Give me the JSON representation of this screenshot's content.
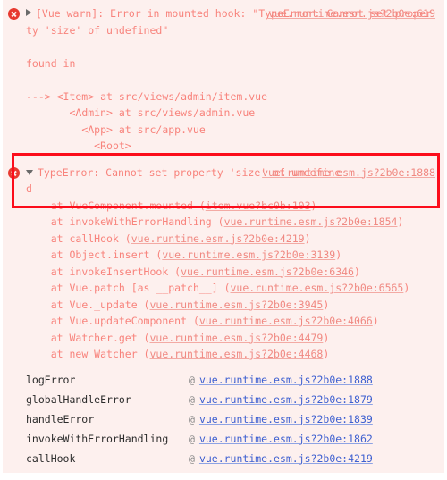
{
  "panel": {
    "name": "browser-devtools-console",
    "background_color": "#fdf0ee",
    "error_text_color": "#f8837c",
    "link_color": "#3d5fd0",
    "highlight_color": "#fc0d1b"
  },
  "entries": [
    {
      "icon": "error-icon",
      "disclosure": "collapsed",
      "message": "[Vue warn]: Error in mounted hook: \"TypeError: Cannot set property 'size' of undefined\"\n\nfound in\n\n---> <Item> at src/views/admin/item.vue\n       <Admin> at src/views/admin.vue\n         <App> at src/app.vue\n           <Root>",
      "source": "vue.runtime.esm.js?2b0e:619"
    },
    {
      "icon": "error-icon",
      "disclosure": "expanded",
      "message_head": "TypeError: Cannot set property 'size' of undefined",
      "source": "vue.runtime.esm.js?2b0e:1888",
      "stack_frames": [
        {
          "fn": "    at VueComponent.mounted (",
          "link": "item.vue?bc0b:103",
          "tail": ")"
        },
        {
          "fn": "    at invokeWithErrorHandling (",
          "link": "vue.runtime.esm.js?2b0e:1854",
          "tail": ")"
        },
        {
          "fn": "    at callHook (",
          "link": "vue.runtime.esm.js?2b0e:4219",
          "tail": ")"
        },
        {
          "fn": "    at Object.insert (",
          "link": "vue.runtime.esm.js?2b0e:3139",
          "tail": ")"
        },
        {
          "fn": "    at invokeInsertHook (",
          "link": "vue.runtime.esm.js?2b0e:6346",
          "tail": ")"
        },
        {
          "fn": "    at Vue.patch [as __patch__] (",
          "link": "vue.runtime.esm.js?2b0e:6565",
          "tail": ")"
        },
        {
          "fn": "    at Vue._update (",
          "link": "vue.runtime.esm.js?2b0e:3945",
          "tail": ")"
        },
        {
          "fn": "    at Vue.updateComponent (",
          "link": "vue.runtime.esm.js?2b0e:4066",
          "tail": ")"
        },
        {
          "fn": "    at Watcher.get (",
          "link": "vue.runtime.esm.js?2b0e:4479",
          "tail": ")"
        },
        {
          "fn": "    at new Watcher (",
          "link": "vue.runtime.esm.js?2b0e:4468",
          "tail": ")"
        }
      ]
    }
  ],
  "call_stack": {
    "at_symbol": "@",
    "rows": [
      {
        "fn": "logError",
        "src": "vue.runtime.esm.js?2b0e:1888"
      },
      {
        "fn": "globalHandleError",
        "src": "vue.runtime.esm.js?2b0e:1879"
      },
      {
        "fn": "handleError",
        "src": "vue.runtime.esm.js?2b0e:1839"
      },
      {
        "fn": "invokeWithErrorHandling",
        "src": "vue.runtime.esm.js?2b0e:1862"
      },
      {
        "fn": "callHook",
        "src": "vue.runtime.esm.js?2b0e:4219"
      }
    ]
  }
}
